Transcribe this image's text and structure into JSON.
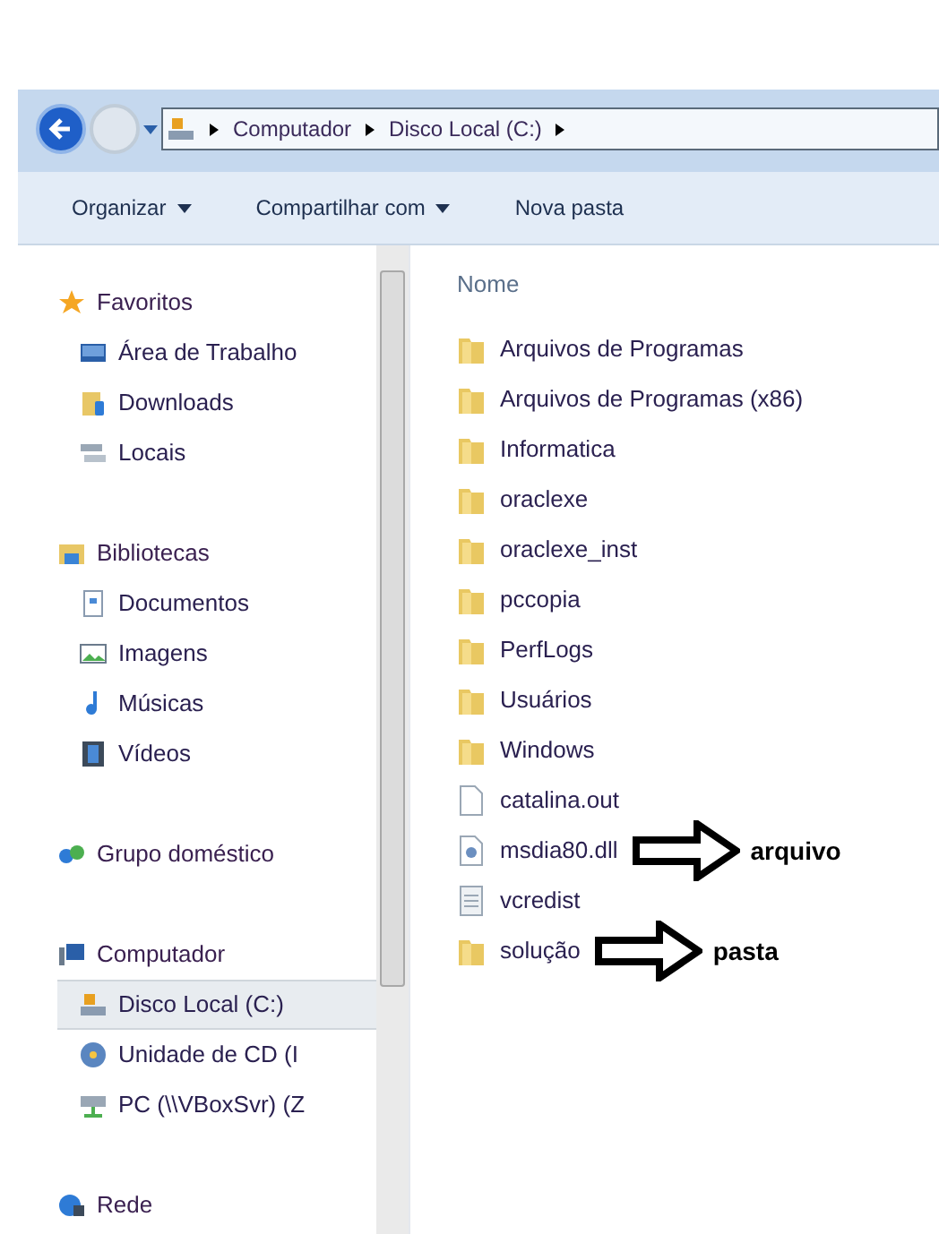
{
  "address_bar": {
    "path": [
      "Computador",
      "Disco Local (C:)"
    ]
  },
  "toolbar": [
    {
      "label": "Organizar",
      "dropdown": true
    },
    {
      "label": "Compartilhar com",
      "dropdown": true
    },
    {
      "label": "Nova pasta",
      "dropdown": false
    }
  ],
  "nav_tree": [
    {
      "label": "Favoritos",
      "kind": "star",
      "children": [
        {
          "label": "Área de Trabalho",
          "kind": "desktop",
          "selected": false
        },
        {
          "label": "Downloads",
          "kind": "downloads",
          "selected": false
        },
        {
          "label": "Locais",
          "kind": "places",
          "selected": false
        }
      ]
    },
    {
      "label": "Bibliotecas",
      "kind": "library",
      "children": [
        {
          "label": "Documentos",
          "kind": "document",
          "selected": false
        },
        {
          "label": "Imagens",
          "kind": "image",
          "selected": false
        },
        {
          "label": "Músicas",
          "kind": "music",
          "selected": false
        },
        {
          "label": "Vídeos",
          "kind": "video",
          "selected": false
        }
      ]
    },
    {
      "label": "Grupo doméstico",
      "kind": "homegroup"
    },
    {
      "label": "Computador",
      "kind": "computer",
      "children": [
        {
          "label": "Disco Local (C:)",
          "kind": "drive",
          "selected": true
        },
        {
          "label": "Unidade de CD (I",
          "kind": "cd",
          "selected": false
        },
        {
          "label": "PC (\\\\VBoxSvr) (Z",
          "kind": "network-drive",
          "selected": false
        }
      ]
    },
    {
      "label": "Rede",
      "kind": "network"
    }
  ],
  "file_list": {
    "column": "Nome",
    "items": [
      {
        "name": "Arquivos de Programas",
        "kind": "folder"
      },
      {
        "name": "Arquivos de Programas (x86)",
        "kind": "folder"
      },
      {
        "name": "Informatica",
        "kind": "folder"
      },
      {
        "name": "oraclexe",
        "kind": "folder"
      },
      {
        "name": "oraclexe_inst",
        "kind": "folder"
      },
      {
        "name": "pccopia",
        "kind": "folder"
      },
      {
        "name": "PerfLogs",
        "kind": "folder"
      },
      {
        "name": "Usuários",
        "kind": "folder"
      },
      {
        "name": "Windows",
        "kind": "folder"
      },
      {
        "name": "catalina.out",
        "kind": "file"
      },
      {
        "name": "msdia80.dll",
        "kind": "dll",
        "annotation": "arquivo"
      },
      {
        "name": "vcredist",
        "kind": "text"
      },
      {
        "name": "solução",
        "kind": "folder",
        "annotation": "pasta"
      }
    ]
  }
}
